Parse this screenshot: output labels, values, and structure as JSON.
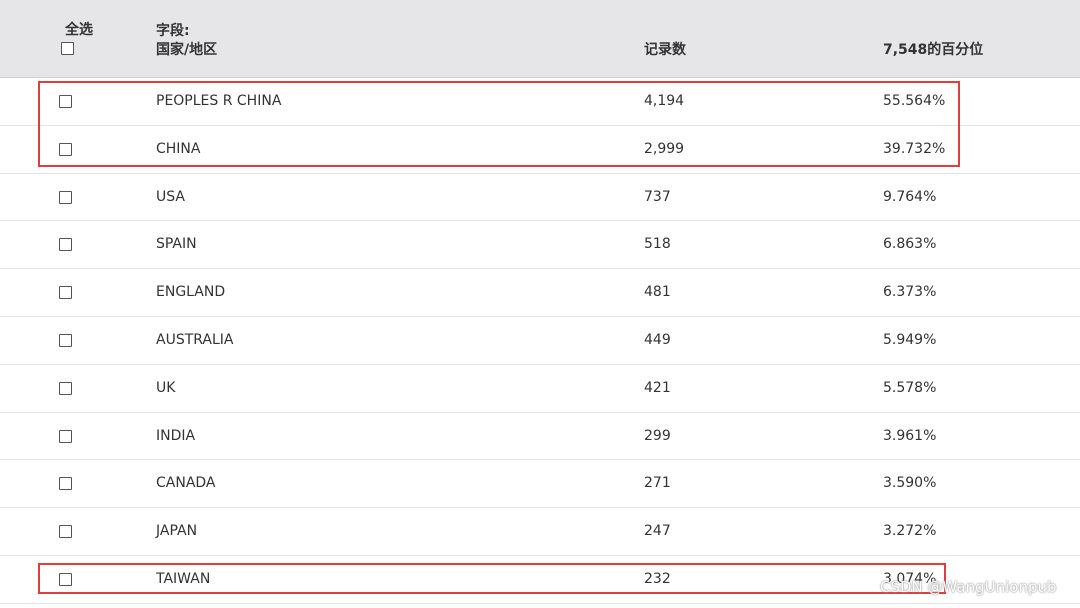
{
  "header": {
    "select_all_label": "全选",
    "field_prefix": "字段:",
    "field_name": "国家/地区",
    "count_header": "记录数",
    "percent_header": "7,548的百分位"
  },
  "rows": [
    {
      "name": "PEOPLES R CHINA",
      "count": "4,194",
      "percent": "55.564%"
    },
    {
      "name": "CHINA",
      "count": "2,999",
      "percent": "39.732%"
    },
    {
      "name": "USA",
      "count": "737",
      "percent": "9.764%"
    },
    {
      "name": "SPAIN",
      "count": "518",
      "percent": "6.863%"
    },
    {
      "name": "ENGLAND",
      "count": "481",
      "percent": "6.373%"
    },
    {
      "name": "AUSTRALIA",
      "count": "449",
      "percent": "5.949%"
    },
    {
      "name": "UK",
      "count": "421",
      "percent": "5.578%"
    },
    {
      "name": "INDIA",
      "count": "299",
      "percent": "3.961%"
    },
    {
      "name": "CANADA",
      "count": "271",
      "percent": "3.590%"
    },
    {
      "name": "JAPAN",
      "count": "247",
      "percent": "3.272%"
    },
    {
      "name": "TAIWAN",
      "count": "232",
      "percent": "3.074%"
    }
  ],
  "highlight_color": "#e23c3c",
  "watermark": "CSDN @WangUnionpub"
}
